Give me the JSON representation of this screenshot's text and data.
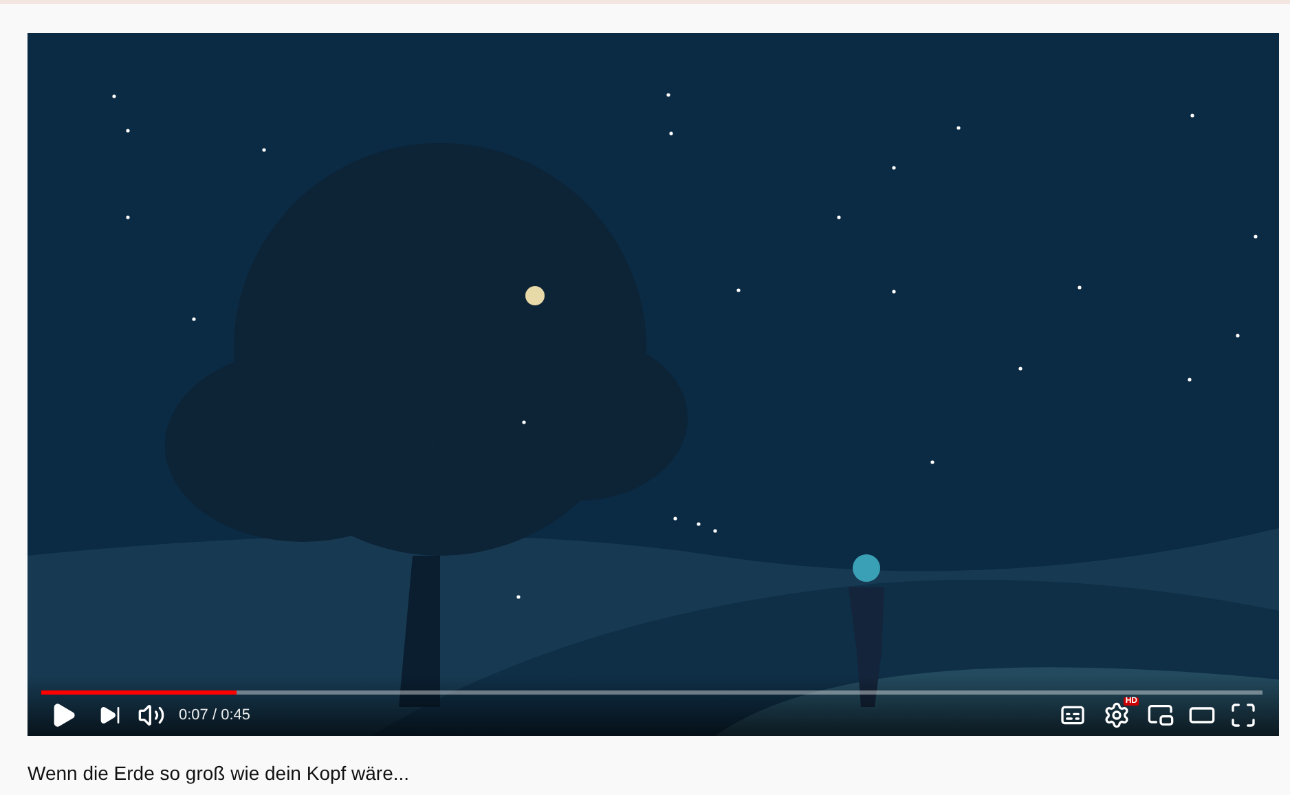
{
  "video": {
    "kind": "picture",
    "progress": {
      "level": 0.16
    },
    "time": "0:07 / 0:45",
    "settings_badge": "HD"
  },
  "caption": "Wenn die Erde so groß wie dein Kopf wäre..."
}
